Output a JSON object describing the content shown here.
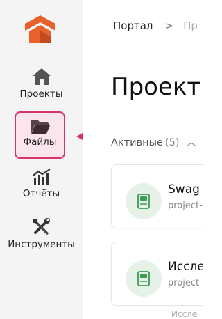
{
  "sidebar": {
    "logo": "brand-logo",
    "items": [
      {
        "label": "Проекты",
        "icon": "home-icon"
      },
      {
        "label": "Файлы",
        "icon": "folder-open-icon",
        "active": true
      },
      {
        "label": "Отчёты",
        "icon": "chart-icon"
      },
      {
        "label": "Инструменты",
        "icon": "tools-icon"
      }
    ]
  },
  "breadcrumb": {
    "items": [
      "Портал",
      "Пр"
    ],
    "separator": ">"
  },
  "main": {
    "title": "Проекты",
    "section": {
      "label": "Активные",
      "count": "(5)",
      "toggle_icon": "chevron-up-icon"
    },
    "projects": [
      {
        "name": "Swag",
        "slug": "project-"
      },
      {
        "name": "Иссле",
        "slug": "project-",
        "sub": "Иссле"
      }
    ]
  },
  "colors": {
    "accent": "#d6336c",
    "logo_orange": "#e8612c",
    "project_icon_green": "#3f9a56"
  }
}
